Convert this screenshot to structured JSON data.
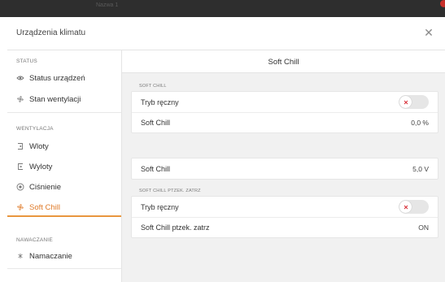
{
  "window": {
    "ghost_title": "Nazwa 1"
  },
  "dialog": {
    "title": "Urządzenia klimatu",
    "close_icon": "close-icon"
  },
  "sidebar": {
    "sections": [
      {
        "label": "STATUS"
      },
      {
        "label": "WENTYLACJA"
      },
      {
        "label": "NAWACZANIE"
      }
    ],
    "items": [
      {
        "label": "Status urządzeń",
        "icon": "eye-icon"
      },
      {
        "label": "Stan wentylacji",
        "icon": "fan-icon"
      },
      {
        "label": "Wloty",
        "icon": "inlet-icon"
      },
      {
        "label": "Wyloty",
        "icon": "outlet-icon"
      },
      {
        "label": "Ciśnienie",
        "icon": "pressure-gauge-icon"
      },
      {
        "label": "Soft Chill",
        "icon": "fan-icon",
        "active": true
      },
      {
        "label": "Namaczanie",
        "icon": "spray-icon"
      }
    ]
  },
  "main": {
    "title": "Soft Chill",
    "groups": [
      {
        "label": "SOFT CHILL",
        "rows": [
          {
            "label": "Tryb ręczny",
            "type": "toggle",
            "state": "off"
          },
          {
            "label": "Soft Chill",
            "value": "0,0 %"
          }
        ]
      },
      {
        "label": "",
        "rows": [
          {
            "label": "Soft Chill",
            "value": "5,0 V"
          }
        ]
      },
      {
        "label": "SOFT CHILL PTZEK. ZATRZ",
        "rows": [
          {
            "label": "Tryb ręczny",
            "type": "toggle",
            "state": "off"
          },
          {
            "label": "Soft Chill ptzek. zatrz",
            "value": "ON"
          }
        ]
      }
    ]
  },
  "colors": {
    "accent": "#e07b2a",
    "toggle_off_x": "#d9363e",
    "content_bg": "#f1f1f1"
  }
}
